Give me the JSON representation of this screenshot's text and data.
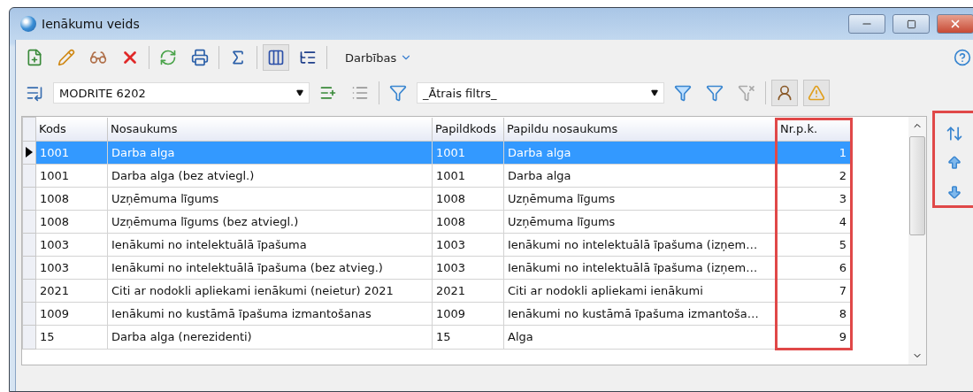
{
  "window": {
    "title": "Ienākumu veids"
  },
  "toolbar": {
    "menu_label": "Darbības",
    "buttons": [
      {
        "kind": "new",
        "pressed": false
      },
      {
        "kind": "edit",
        "pressed": false
      },
      {
        "kind": "view",
        "pressed": false
      },
      {
        "kind": "delete",
        "pressed": false
      },
      {
        "kind": "sep"
      },
      {
        "kind": "refresh",
        "pressed": false
      },
      {
        "kind": "print",
        "pressed": false
      },
      {
        "kind": "sep"
      },
      {
        "kind": "sum",
        "pressed": false
      },
      {
        "kind": "sep"
      },
      {
        "kind": "columns",
        "pressed": true
      },
      {
        "kind": "tree",
        "pressed": false
      },
      {
        "kind": "sep"
      }
    ]
  },
  "filterbar": {
    "profile": "MODRITE 6202",
    "filter": "_Ātrais filtrs_"
  },
  "table": {
    "columns": [
      {
        "label": "Kods",
        "highlighted": false
      },
      {
        "label": "Nosaukums",
        "highlighted": false
      },
      {
        "label": "Papildkods",
        "highlighted": false
      },
      {
        "label": "Papildu nosaukums",
        "highlighted": false
      },
      {
        "label": "Nr.p.k.",
        "highlighted": true
      }
    ],
    "rows": [
      {
        "selected": true,
        "cells": [
          "1001",
          "Darba alga",
          "1001",
          "Darba alga",
          "1"
        ]
      },
      {
        "selected": false,
        "cells": [
          "1001",
          "Darba alga (bez atviegl.)",
          "1001",
          "Darba alga",
          "2"
        ]
      },
      {
        "selected": false,
        "cells": [
          "1008",
          "Uzņēmuma līgums",
          "1008",
          "Uzņēmuma līgums",
          "3"
        ]
      },
      {
        "selected": false,
        "cells": [
          "1008",
          "Uzņēmuma līgums (bez atviegl.)",
          "1008",
          "Uzņēmuma līgums",
          "4"
        ]
      },
      {
        "selected": false,
        "cells": [
          "1003",
          "Ienākumi no intelektuālā īpašuma",
          "1003",
          "Ienākumi no intelektuālā īpašuma (izņem…",
          "5"
        ]
      },
      {
        "selected": false,
        "cells": [
          "1003",
          "Ienākumi no intelektuālā īpašuma (bez atvieg.)",
          "1003",
          "Ienākumi no intelektuālā īpašuma (izņem…",
          "6"
        ]
      },
      {
        "selected": false,
        "cells": [
          "2021",
          "Citi ar nodokli apliekami ienākumi (neietur) 2021",
          "2021",
          "Citi ar nodokli apliekami ienākumi",
          "7"
        ]
      },
      {
        "selected": false,
        "cells": [
          "1009",
          "Ienākumi no kustāmā īpašuma izmantošanas",
          "1009",
          "Ienākumi no kustāmā īpašuma izmantoša…",
          "8"
        ]
      },
      {
        "selected": false,
        "cells": [
          "15",
          "Darba alga (nerezidenti)",
          "15",
          "Alga",
          "9"
        ]
      }
    ]
  },
  "side_panel": {
    "highlighted": true
  }
}
